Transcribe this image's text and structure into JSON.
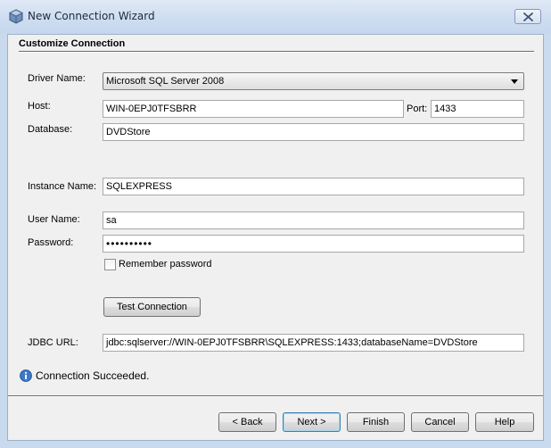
{
  "window": {
    "title": "New Connection Wizard",
    "close_label": "close"
  },
  "section": {
    "title": "Customize Connection"
  },
  "form": {
    "driver_label": "Driver Name:",
    "driver_value": "Microsoft SQL Server 2008",
    "host_label": "Host:",
    "host_value": "WIN-0EPJ0TFSBRR",
    "port_label": "Port:",
    "port_value": "1433",
    "database_label": "Database:",
    "database_value": "DVDStore",
    "instance_label": "Instance Name:",
    "instance_value": "SQLEXPRESS",
    "username_label": "User Name:",
    "username_value": "sa",
    "password_label": "Password:",
    "password_value": "••••••••••",
    "remember_label": "Remember password",
    "remember_checked": false,
    "test_button": "Test Connection",
    "jdbc_label": "JDBC URL:",
    "jdbc_value": "jdbc:sqlserver://WIN-0EPJ0TFSBRR\\SQLEXPRESS:1433;databaseName=DVDStore"
  },
  "status": {
    "icon": "info-icon",
    "text": "Connection Succeeded."
  },
  "buttons": {
    "back": "< Back",
    "next": "Next >",
    "finish": "Finish",
    "cancel": "Cancel",
    "help": "Help"
  },
  "colors": {
    "title_bar": "#cddcf0",
    "dialog_bg": "#f0f0f0",
    "default_button_border": "#3c7fb1",
    "info_icon": "#3b78c8"
  }
}
